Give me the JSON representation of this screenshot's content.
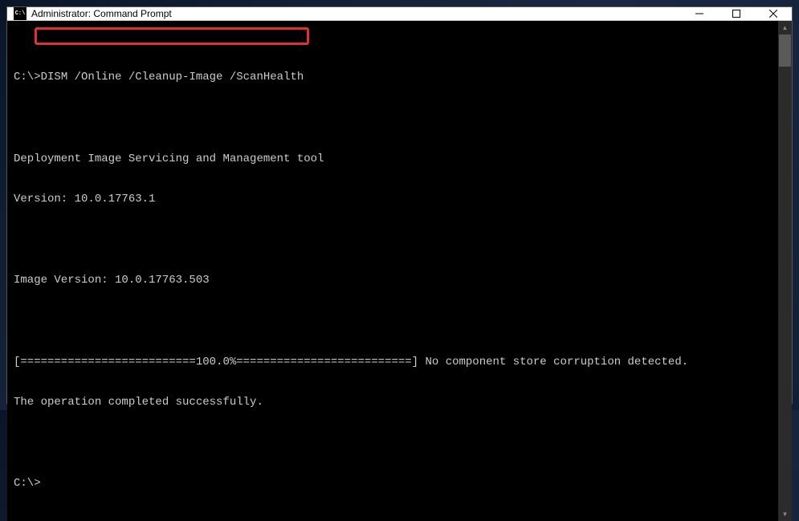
{
  "window": {
    "title": "Administrator: Command Prompt",
    "icon_text": "C:\\"
  },
  "terminal": {
    "prompt1_prefix": "C:\\>",
    "command": "DISM /Online /Cleanup-Image /ScanHealth",
    "blank1": "",
    "tool_name": "Deployment Image Servicing and Management tool",
    "version_line": "Version: 10.0.17763.1",
    "blank2": "",
    "image_version": "Image Version: 10.0.17763.503",
    "blank3": "",
    "progress_line": "[==========================100.0%==========================] No component store corruption detected.",
    "completion": "The operation completed successfully.",
    "blank4": "",
    "prompt2": "C:\\>"
  }
}
